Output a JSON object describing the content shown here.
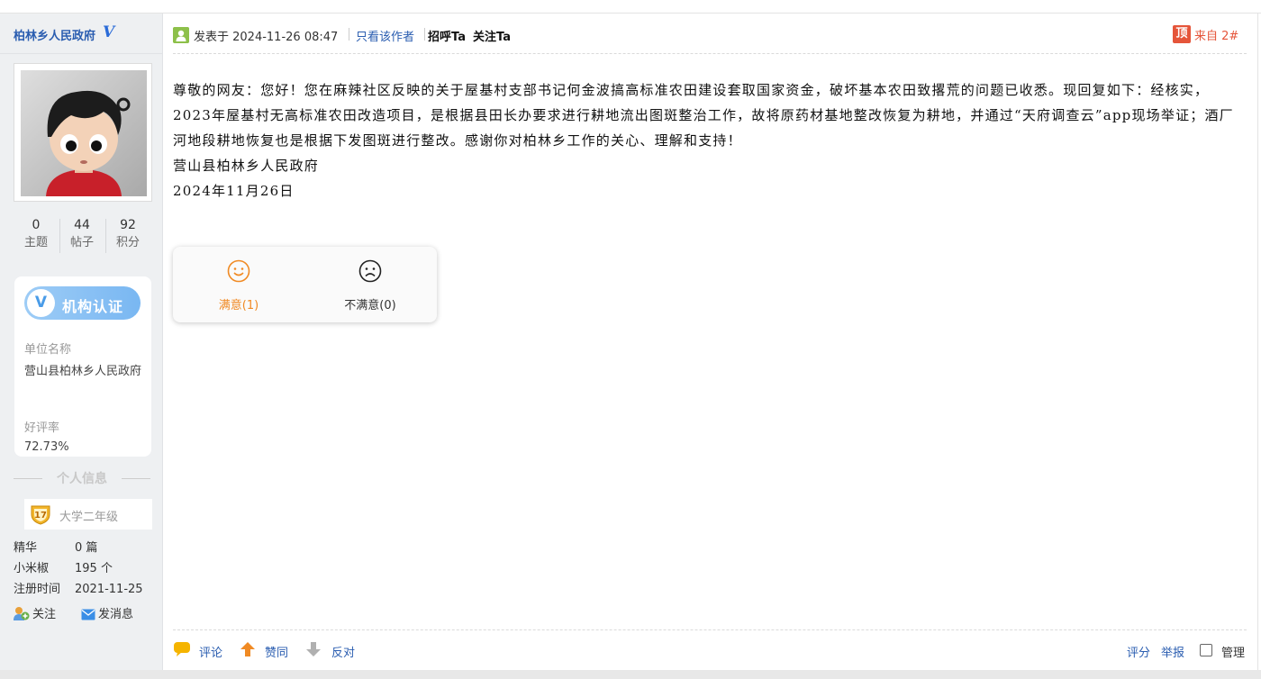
{
  "sidebar": {
    "author_name": "柏林乡人民政府",
    "verified_mark": "V",
    "stats": [
      {
        "num": "0",
        "label": "主题"
      },
      {
        "num": "44",
        "label": "帖子"
      },
      {
        "num": "92",
        "label": "积分"
      }
    ],
    "org": {
      "badge_text": "机构认证",
      "badge_mark": "V",
      "unit_label": "单位名称",
      "unit_value": "营山县柏林乡人民政府",
      "rating_label": "好评率",
      "rating_value": "72.73%"
    },
    "info_title": "个人信息",
    "level": {
      "number": "17",
      "title": "大学二年级"
    },
    "meta": [
      {
        "key": "精华",
        "value": "0 篇"
      },
      {
        "key": "小米椒",
        "value": "195 个"
      },
      {
        "key": "注册时间",
        "value": "2021-11-25"
      }
    ],
    "actions": {
      "follow": "关注",
      "message": "发消息"
    }
  },
  "post": {
    "posted_at": "发表于 2024-11-26 08:47",
    "only_author": "只看该作者",
    "greet": "招呼Ta",
    "follow": "关注Ta",
    "top_badge": "顶",
    "floor": "来自 2#",
    "body": [
      "尊敬的网友：您好！您在麻辣社区反映的关于屋基村支部书记何金波搞高标准农田建设套取国家资金，破坏基本农田致撂荒的问题已收悉。现回复如下：经核实，2023年屋基村无高标准农田改造项目，是根据县田长办要求进行耕地流出图斑整治工作，故将原药材基地整改恢复为耕地，并通过“天府调查云”app现场举证；酒厂河地段耕地恢复也是根据下发图斑进行整改。感谢你对柏林乡工作的关心、理解和支持！",
      "营山县柏林乡人民政府",
      "2024年11月26日"
    ],
    "vote": {
      "satisfied": "满意(1)",
      "unsatisfied": "不满意(0)"
    },
    "footer": {
      "comment": "评论",
      "like": "赞同",
      "oppose": "反对",
      "rate": "评分",
      "report": "举报",
      "manage": "管理"
    }
  },
  "colors": {
    "link": "#2a5db0",
    "accent_orange": "#f08a24",
    "top_red": "#e5553a",
    "sidebar_bg": "#eef0f2"
  }
}
